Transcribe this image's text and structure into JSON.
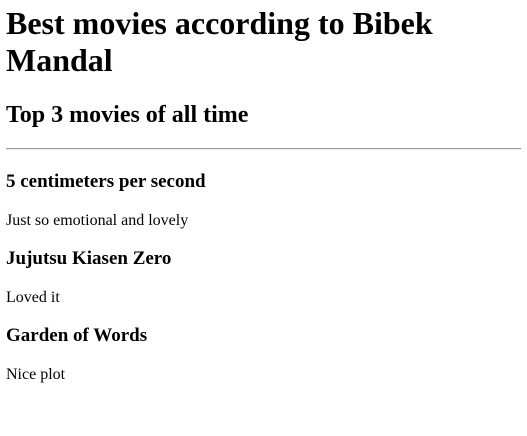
{
  "page": {
    "title": "Best movies according to Bibek Mandal",
    "subtitle": "Top 3 movies of all time"
  },
  "movies": [
    {
      "title": "5 centimeters per second",
      "description": "Just so emotional and lovely"
    },
    {
      "title": "Jujutsu Kiasen Zero",
      "description": "Loved it"
    },
    {
      "title": "Garden of Words",
      "description": "Nice plot"
    }
  ]
}
